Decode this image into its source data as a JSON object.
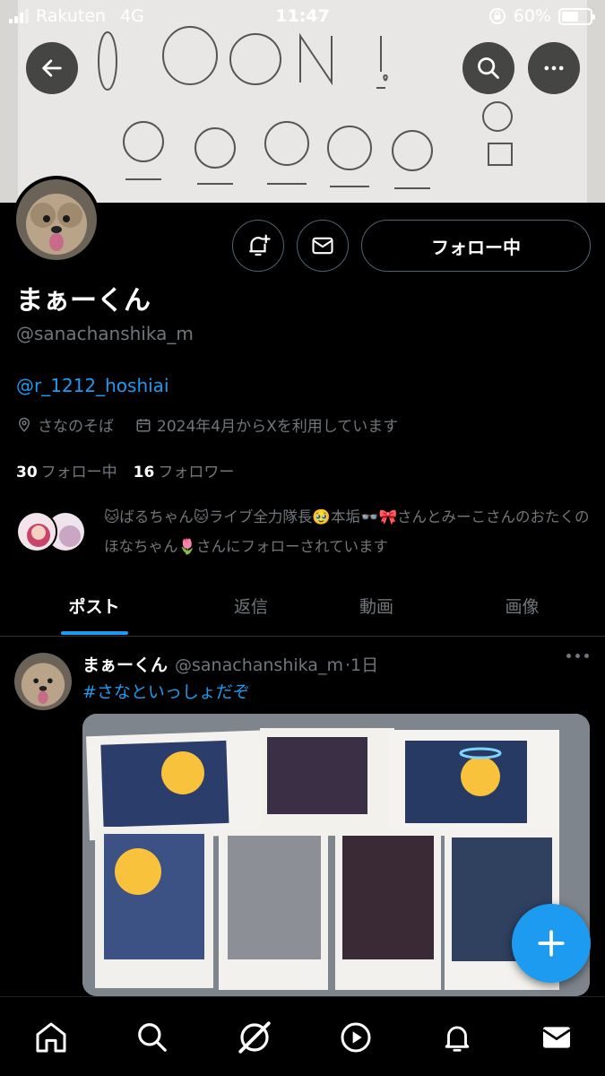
{
  "status_bar": {
    "carrier": "Rakuten",
    "network": "4G",
    "time": "11:47",
    "battery": "60%",
    "battery_level": 0.6
  },
  "header": {
    "back_icon": "arrow-left-icon",
    "search_icon": "search-icon",
    "more_icon": "more-horizontal-icon"
  },
  "profile": {
    "display_name": "まぁーくん",
    "handle": "@sanachanshika_m",
    "bio_link": "@r_1212_hoshiai",
    "location": "さなのそば",
    "joined": "2024年4月からXを利用しています",
    "following_count": "30",
    "following_label": "フォロー中",
    "followers_count": "16",
    "followers_label": "フォロワー",
    "follow_button": "フォロー中",
    "known_followers_text": "🐱ばるちゃん🐱ライブ全力隊長🥹本垢👓🎀さんとみーこさんのおたくのほなちゃん🌷さんにフォローされています"
  },
  "tabs": [
    {
      "label": "ポスト",
      "active": true
    },
    {
      "label": "返信",
      "active": false
    },
    {
      "label": "動画",
      "active": false
    },
    {
      "label": "画像",
      "active": false
    }
  ],
  "post": {
    "name": "まぁーくん",
    "handle": "@sanachanshika_m",
    "time": "·1日",
    "hashtag": "#さなといっしょだぞ"
  },
  "bottom_nav": [
    "home-icon",
    "search-icon",
    "grok-icon",
    "video-icon",
    "notifications-icon",
    "messages-icon"
  ],
  "colors": {
    "accent": "#1d9bf0",
    "background": "#000000",
    "secondary_text": "#71767b",
    "border": "#536471"
  }
}
